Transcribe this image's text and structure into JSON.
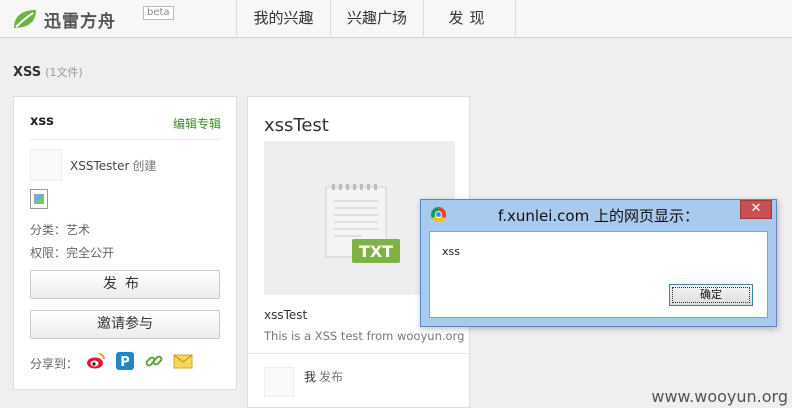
{
  "header": {
    "logo_text": "迅雷方舟",
    "beta": "beta",
    "nav": [
      "我的兴趣",
      "兴趣广场",
      "发现"
    ]
  },
  "page": {
    "title": "XSS",
    "file_count": "(1文件)"
  },
  "album": {
    "name": "xss",
    "edit_label": "编辑专辑",
    "creator": "XSSTester",
    "creator_suffix": "创建",
    "category": "分类：艺术",
    "permission": "权限：完全公开",
    "publish_label": "发布",
    "invite_label": "邀请参与",
    "share_label": "分享到：",
    "share_icons": [
      "weibo-icon",
      "qzone-icon",
      "link-icon",
      "email-icon"
    ]
  },
  "file": {
    "title": "xssTest",
    "badge": "TXT",
    "name": "xssTest",
    "description": "This is a XSS test from wooyun.org",
    "publisher": "我",
    "publisher_action": "发布"
  },
  "dialog": {
    "title": "f.xunlei.com 上的网页显示：",
    "close": "✕",
    "message": "xss",
    "ok_label": "确定"
  },
  "watermark": "www.wooyun.org",
  "colors": {
    "accent_green": "#3c8c2a",
    "txt_badge": "#7cb342",
    "dialog_frame": "#a9c9ef",
    "close_red": "#c75050"
  }
}
